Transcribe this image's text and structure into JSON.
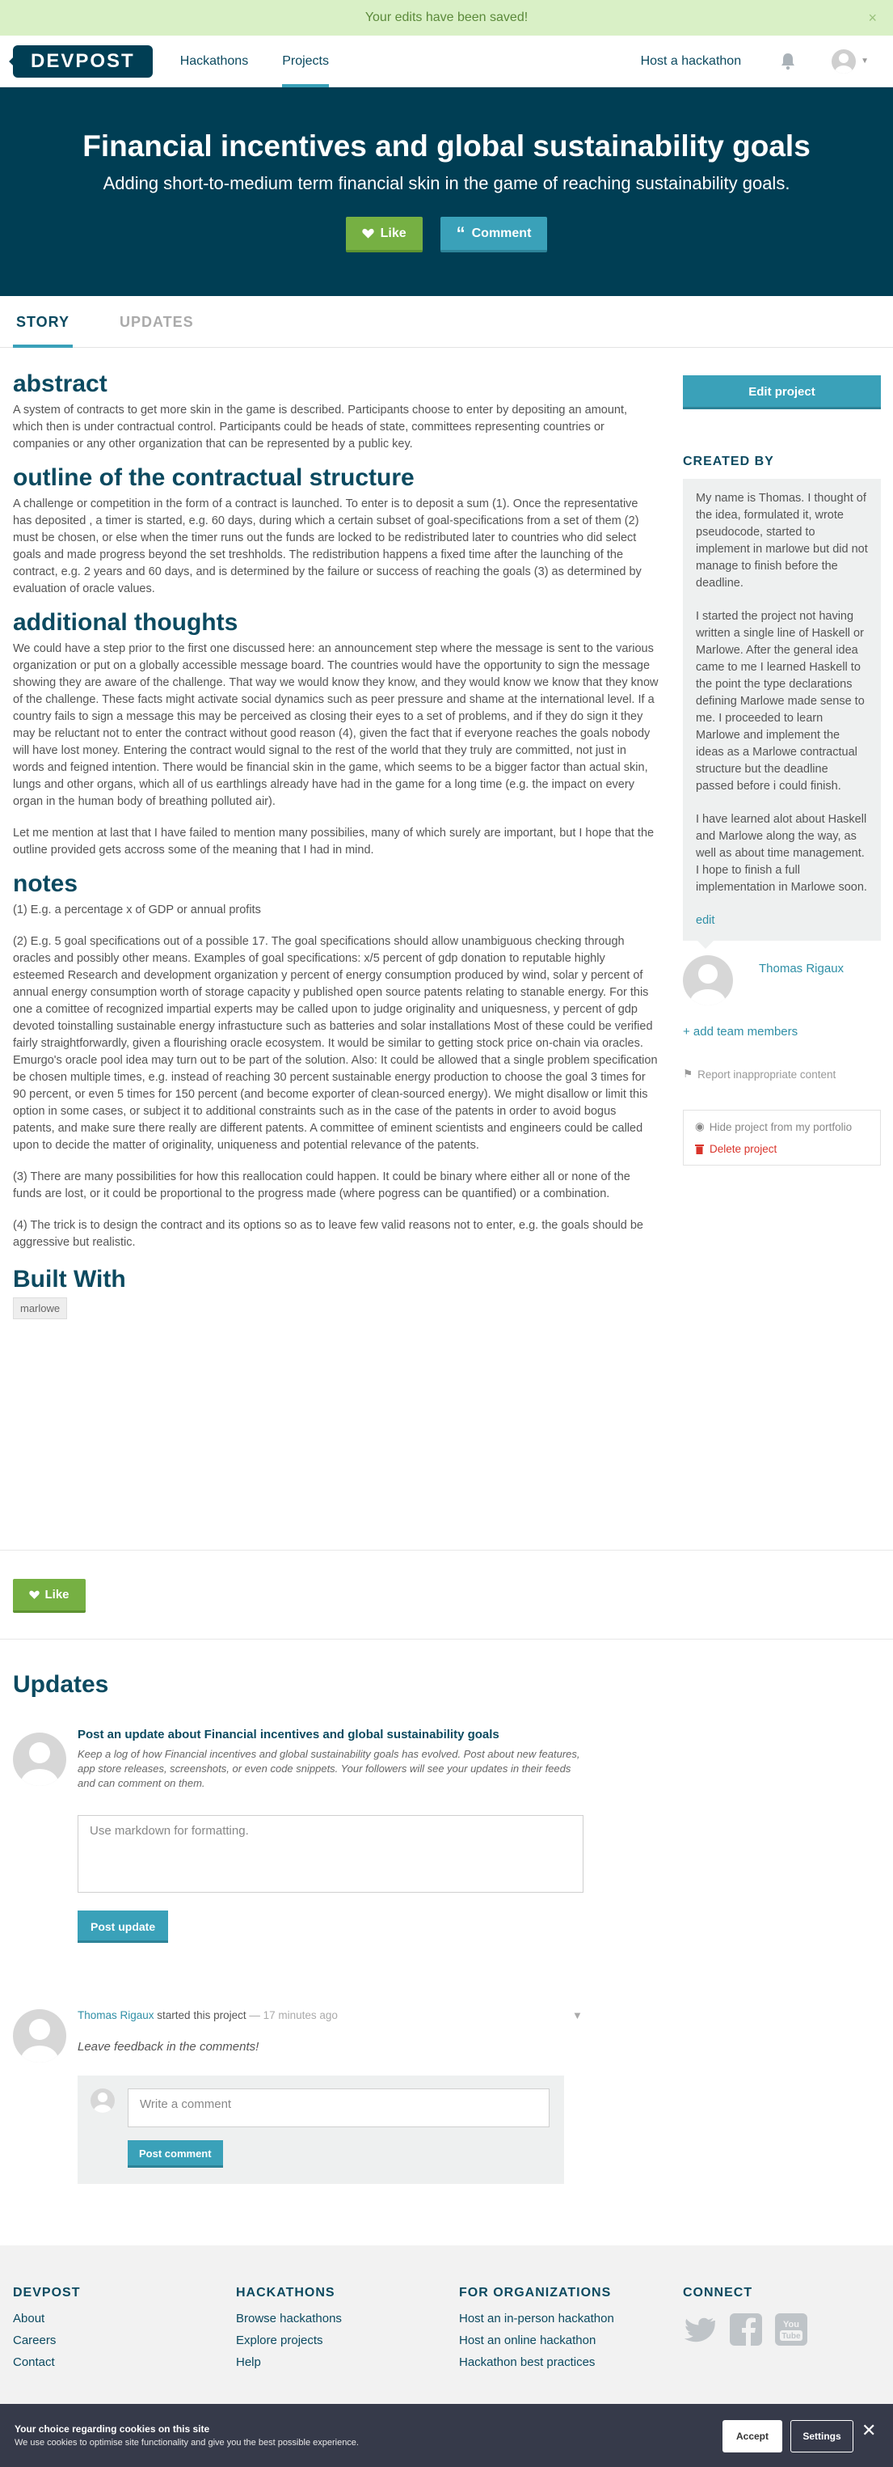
{
  "flash": {
    "message": "Your edits have been saved!",
    "close": "×"
  },
  "nav": {
    "logo": "DEVPOST",
    "links": [
      "Hackathons",
      "Projects"
    ],
    "active_link": "Projects",
    "host": "Host a hackathon",
    "icons": [
      "bell-icon",
      "avatar-icon",
      "chevron-down-icon"
    ]
  },
  "hero": {
    "title": "Financial incentives and global sustainability goals",
    "tagline": "Adding short-to-medium term financial skin in the game of reaching sustainability goals.",
    "like": "Like",
    "comment": "Comment"
  },
  "tabs": [
    "STORY",
    "UPDATES"
  ],
  "story": {
    "abstract_h": "abstract",
    "abstract_p": "A system of contracts to get more skin in the game is described. Participants choose to enter by depositing an amount, which then is under contractual control. Participants could be heads of state, committees representing countries or companies or any other organization that can be represented by a public key.",
    "outline_h": "outline of the contractual structure",
    "outline_p": "A challenge or competition in the form of a contract is launched. To enter is to deposit a sum (1). Once the representative has deposited , a timer is started, e.g. 60 days, during which a certain subset of goal-specifications from a set of them (2) must be chosen, or else when the timer runs out the funds are locked to be redistributed later to countries who did select goals and made progress beyond the set treshholds. The redistribution happens a fixed time after the launching of the contract, e.g. 2 years and 60 days, and is determined by the failure or success of reaching the goals (3) as determined by evaluation of oracle values.",
    "thoughts_h": "additional thoughts",
    "thoughts_p1": "We could have a step prior to the first one discussed here: an announcement step where the message is sent to the various organization or put on a globally accessible message board. The countries would have the opportunity to sign the message showing they are aware of the challenge. That way we would know they know, and they would know we know that they know of the challenge. These facts might activate social dynamics such as peer pressure and shame at the international level. If a country fails to sign a message this may be perceived as closing their eyes to a set of problems, and if they do sign it they may be reluctant not to enter the contract without good reason (4), given the fact that if everyone reaches the goals nobody will have lost money. Entering the contract would signal to the rest of the world that they truly are committed, not just in words and feigned intention. There would be financial skin in the game, which seems to be a bigger factor than actual skin, lungs and other organs, which all of us earthlings already have had in the game for a long time (e.g. the impact on every organ in the human body of breathing polluted air).",
    "thoughts_p2": "Let me mention at last that I have failed to mention many possibilies, many of which surely are important, but I hope that the outline provided gets accross some of the meaning that I had in mind.",
    "notes_h": "notes",
    "notes": [
      "(1) E.g. a percentage x of GDP or annual profits",
      "(2) E.g. 5 goal specifications out of a possible 17. The goal specifications should allow unambiguous checking through oracles and possibly other means. Examples of goal specifications: x/5 percent of gdp donation to reputable highly esteemed Research and development organization y percent of energy consumption produced by wind, solar y percent of annual energy consumption worth of storage capacity y published open source patents relating to stanable energy. For this one a comittee of recognized impartial experts may be called upon to judge originality and uniquesness, y percent of gdp devoted toinstalling sustainable energy infrastucture such as batteries and solar installations Most of these could be verified fairly straightforwardly, given a flourishing oracle ecosystem. It would be similar to getting stock price on-chain via oracles. Emurgo's oracle pool idea may turn out to be part of the solution. Also: It could be allowed that a single problem specification be chosen multiple times, e.g. instead of reaching 30 percent sustainable energy production to choose the goal 3 times for 90 percent, or even 5 times for 150 percent (and become exporter of clean-sourced energy). We might disallow or limit this option in some cases, or subject it to additional constraints such as in the case of the patents in order to avoid bogus patents, and make sure there really are different patents. A committee of eminent scientists and engineers could be called upon to decide the matter of originality, uniqueness and potential relevance of the patents.",
      "(3) There are many possibilities for how this reallocation could happen. It could be binary where either all or none of the funds are lost, or it could be proportional to the progress made (where pogress can be quantified) or a combination.",
      "(4) The trick is to design the contract and its options so as to leave few valid reasons not to enter, e.g. the goals should be aggressive but realistic."
    ],
    "built_h": "Built With",
    "built_tag": "marlowe",
    "like": "Like"
  },
  "sidebar": {
    "edit": "Edit project",
    "created_by": "CREATED BY",
    "bio": [
      "My name is Thomas. I thought of the idea, formulated it, wrote pseudocode, started to implement in marlowe but did not manage to finish before the deadline.",
      "I started the project not having written a single line of Haskell or Marlowe. After the general idea came to me I learned Haskell to the point the type declarations defining Marlowe made sense to me. I proceeded to learn Marlowe and implement the ideas as a Marlowe contractual structure but the deadline passed before i could finish.",
      "I have learned alot about Haskell and Marlowe along the way, as well as about time management. I hope to finish a full implementation in Marlowe soon."
    ],
    "edit_link": "edit",
    "member_name": "Thomas Rigaux",
    "add_team": "+ add team members",
    "report": "Report inappropriate content",
    "hide": "Hide project from my portfolio",
    "delete": "Delete project"
  },
  "updates": {
    "title": "Updates",
    "post_title": "Post an update about Financial incentives and global sustainability goals",
    "post_desc": "Keep a log of how Financial incentives and global sustainability goals has evolved. Post about new features, app store releases, screenshots, or even code snippets. Your followers will see your updates in their feeds and can comment on them.",
    "placeholder": "Use markdown for formatting.",
    "post_btn": "Post update",
    "activity_who": "Thomas Rigaux",
    "activity_action": " started this project ",
    "activity_when": "— 17 minutes ago",
    "feedback": "Leave feedback in the comments!",
    "comment_placeholder": "Write a comment",
    "comment_btn": "Post comment"
  },
  "footer": {
    "cols": [
      {
        "title": "DEVPOST",
        "links": [
          "About",
          "Careers",
          "Contact"
        ]
      },
      {
        "title": "HACKATHONS",
        "links": [
          "Browse hackathons",
          "Explore projects",
          "Help"
        ]
      },
      {
        "title": "FOR ORGANIZATIONS",
        "links": [
          "Host an in-person hackathon",
          "Host an online hackathon",
          "Hackathon best practices"
        ]
      },
      {
        "title": "CONNECT",
        "links": []
      }
    ],
    "social_icons": [
      "twitter-icon",
      "facebook-icon",
      "youtube-icon"
    ]
  },
  "cookie": {
    "title": "Your choice regarding cookies on this site",
    "text": "We use cookies to optimise site functionality and give you the best possible experience.",
    "accept": "Accept",
    "settings": "Settings",
    "close": "✕"
  },
  "colors": {
    "brand": "#003e54",
    "accent": "#3aa1b9",
    "like": "#76b043",
    "flash_bg": "#d9f0c6",
    "danger": "#d9342b"
  }
}
